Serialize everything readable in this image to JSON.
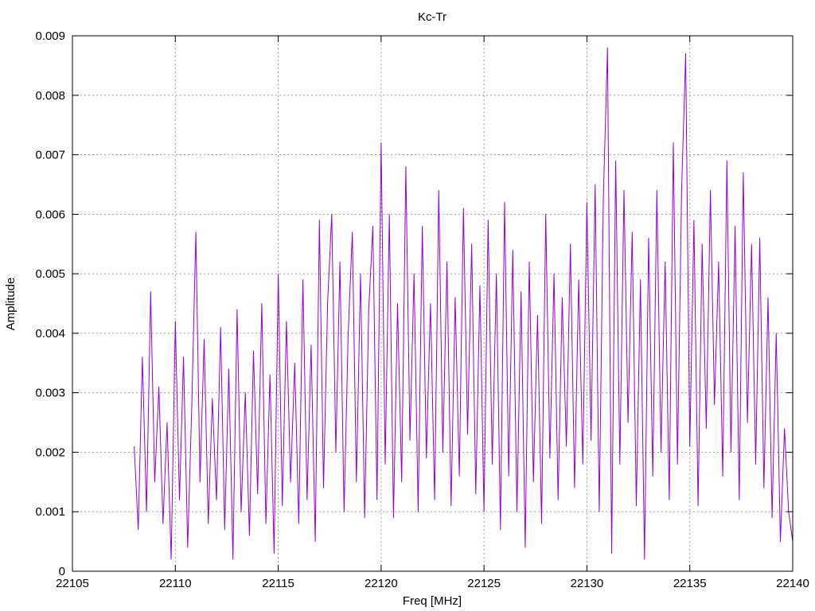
{
  "chart_data": {
    "type": "line",
    "title": "Kc-Tr",
    "xlabel": "Freq [MHz]",
    "ylabel": "Amplitude",
    "xlim": [
      22105,
      22140
    ],
    "ylim": [
      0,
      0.009
    ],
    "xticks": [
      22105,
      22110,
      22115,
      22120,
      22125,
      22130,
      22135,
      22140
    ],
    "yticks": [
      0,
      0.001,
      0.002,
      0.003,
      0.004,
      0.005,
      0.006,
      0.007,
      0.008,
      0.009
    ],
    "ytick_labels": [
      "0",
      "0.001",
      "0.002",
      "0.003",
      "0.004",
      "0.005",
      "0.006",
      "0.007",
      "0.008",
      "0.009"
    ],
    "grid": true,
    "legend": "none",
    "series": [
      {
        "color": "#9400d3",
        "x": [
          22108.0,
          22108.2,
          22108.4,
          22108.6,
          22108.8,
          22109.0,
          22109.2,
          22109.4,
          22109.6,
          22109.8,
          22110.0,
          22110.2,
          22110.4,
          22110.6,
          22110.8,
          22111.0,
          22111.2,
          22111.4,
          22111.6,
          22111.8,
          22112.0,
          22112.2,
          22112.4,
          22112.6,
          22112.8,
          22113.0,
          22113.2,
          22113.4,
          22113.6,
          22113.8,
          22114.0,
          22114.2,
          22114.4,
          22114.6,
          22114.8,
          22115.0,
          22115.2,
          22115.4,
          22115.6,
          22115.8,
          22116.0,
          22116.2,
          22116.4,
          22116.6,
          22116.8,
          22117.0,
          22117.2,
          22117.4,
          22117.6,
          22117.8,
          22118.0,
          22118.2,
          22118.4,
          22118.6,
          22118.8,
          22119.0,
          22119.2,
          22119.4,
          22119.6,
          22119.8,
          22120.0,
          22120.2,
          22120.4,
          22120.6,
          22120.8,
          22121.0,
          22121.2,
          22121.4,
          22121.6,
          22121.8,
          22122.0,
          22122.2,
          22122.4,
          22122.6,
          22122.8,
          22123.0,
          22123.2,
          22123.4,
          22123.6,
          22123.8,
          22124.0,
          22124.2,
          22124.4,
          22124.6,
          22124.8,
          22125.0,
          22125.2,
          22125.4,
          22125.6,
          22125.8,
          22126.0,
          22126.2,
          22126.4,
          22126.6,
          22126.8,
          22127.0,
          22127.2,
          22127.4,
          22127.6,
          22127.8,
          22128.0,
          22128.2,
          22128.4,
          22128.6,
          22128.8,
          22129.0,
          22129.2,
          22129.4,
          22129.6,
          22129.8,
          22130.0,
          22130.2,
          22130.4,
          22130.6,
          22130.8,
          22131.0,
          22131.2,
          22131.4,
          22131.6,
          22131.8,
          22132.0,
          22132.2,
          22132.4,
          22132.6,
          22132.8,
          22133.0,
          22133.2,
          22133.4,
          22133.6,
          22133.8,
          22134.0,
          22134.2,
          22134.4,
          22134.6,
          22134.8,
          22135.0,
          22135.2,
          22135.4,
          22135.6,
          22135.8,
          22136.0,
          22136.2,
          22136.4,
          22136.6,
          22136.8,
          22137.0,
          22137.2,
          22137.4,
          22137.6,
          22137.8,
          22138.0,
          22138.2,
          22138.4,
          22138.6,
          22138.8,
          22139.0,
          22139.2,
          22139.4,
          22139.6,
          22139.8,
          22140.0
        ],
        "y": [
          0.0021,
          0.0007,
          0.0036,
          0.001,
          0.0047,
          0.0015,
          0.0031,
          0.0008,
          0.0025,
          0.0002,
          0.0042,
          0.0012,
          0.0036,
          0.0004,
          0.0028,
          0.0057,
          0.0015,
          0.0039,
          0.0008,
          0.0029,
          0.0012,
          0.0041,
          0.0007,
          0.0034,
          0.0002,
          0.0044,
          0.001,
          0.003,
          0.0006,
          0.0037,
          0.0013,
          0.0045,
          0.0008,
          0.0033,
          0.0003,
          0.005,
          0.0011,
          0.0042,
          0.0015,
          0.0035,
          0.0008,
          0.0049,
          0.0012,
          0.0038,
          0.0005,
          0.0059,
          0.0014,
          0.0045,
          0.006,
          0.002,
          0.0052,
          0.001,
          0.004,
          0.0057,
          0.0015,
          0.005,
          0.0009,
          0.0044,
          0.0058,
          0.0012,
          0.0072,
          0.0018,
          0.006,
          0.0009,
          0.0045,
          0.0015,
          0.0068,
          0.0022,
          0.005,
          0.001,
          0.0058,
          0.0019,
          0.0045,
          0.0012,
          0.0064,
          0.002,
          0.0052,
          0.0011,
          0.0046,
          0.0016,
          0.0061,
          0.0023,
          0.0055,
          0.0013,
          0.0048,
          0.001,
          0.0059,
          0.0018,
          0.005,
          0.0007,
          0.0062,
          0.0016,
          0.0054,
          0.001,
          0.0047,
          0.0004,
          0.0052,
          0.0015,
          0.0043,
          0.0008,
          0.006,
          0.0019,
          0.005,
          0.0012,
          0.0046,
          0.0021,
          0.0055,
          0.0014,
          0.0049,
          0.0018,
          0.0062,
          0.0022,
          0.0065,
          0.001,
          0.0063,
          0.0088,
          0.0003,
          0.0069,
          0.0018,
          0.0064,
          0.0025,
          0.0057,
          0.0011,
          0.0049,
          0.0002,
          0.0056,
          0.0016,
          0.0064,
          0.002,
          0.0052,
          0.0012,
          0.0072,
          0.0018,
          0.0064,
          0.0087,
          0.0021,
          0.0059,
          0.0011,
          0.0055,
          0.0024,
          0.0064,
          0.0028,
          0.0052,
          0.0016,
          0.0069,
          0.002,
          0.0058,
          0.0012,
          0.0067,
          0.0025,
          0.0055,
          0.0018,
          0.0056,
          0.0014,
          0.0046,
          0.0009,
          0.004,
          0.0005,
          0.0024,
          0.001,
          0.0005
        ]
      }
    ]
  }
}
